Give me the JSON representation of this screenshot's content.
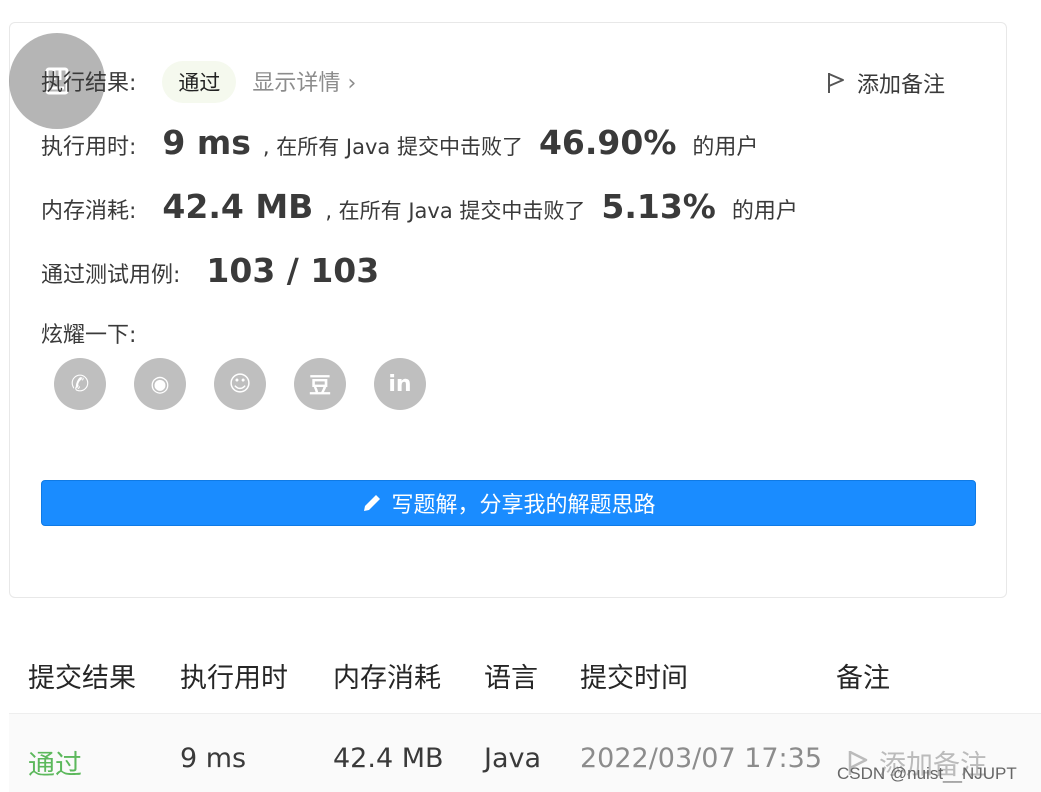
{
  "result": {
    "label": "执行结果:",
    "status": "通过",
    "details_link": "显示详情",
    "details_chevron": "›",
    "add_note": "添加备注"
  },
  "runtime": {
    "label": "执行用时:",
    "value": "9 ms",
    "middle": ", 在所有 Java 提交中击败了",
    "percent": "46.90%",
    "suffix": "的用户"
  },
  "memory": {
    "label": "内存消耗:",
    "value": "42.4 MB",
    "middle": ", 在所有 Java 提交中击败了",
    "percent": "5.13%",
    "suffix": "的用户"
  },
  "tests": {
    "label": "通过测试用例:",
    "value": "103 / 103"
  },
  "share": {
    "label": "炫耀一下:",
    "items": [
      {
        "icon": "wechat-icon",
        "glyph": "✆"
      },
      {
        "icon": "weibo-icon",
        "glyph": "◉"
      },
      {
        "icon": "qq-icon",
        "glyph": "☺"
      },
      {
        "icon": "douban-icon",
        "glyph": "豆"
      },
      {
        "icon": "linkedin-icon",
        "glyph": "in"
      }
    ]
  },
  "solution_button": {
    "label": "写题解，分享我的解题思路"
  },
  "table": {
    "headers": [
      "提交结果",
      "执行用时",
      "内存消耗",
      "语言",
      "提交时间",
      "备注"
    ],
    "row": {
      "status": "通过",
      "runtime": "9 ms",
      "memory": "42.4 MB",
      "language": "Java",
      "time": "2022/03/07 17:35",
      "note": "添加备注"
    }
  },
  "colors": {
    "accent": "#1a8cff",
    "success": "#5cb85c",
    "muted": "#bfbfbf"
  },
  "watermark": "CSDN @nuist__NJUPT"
}
